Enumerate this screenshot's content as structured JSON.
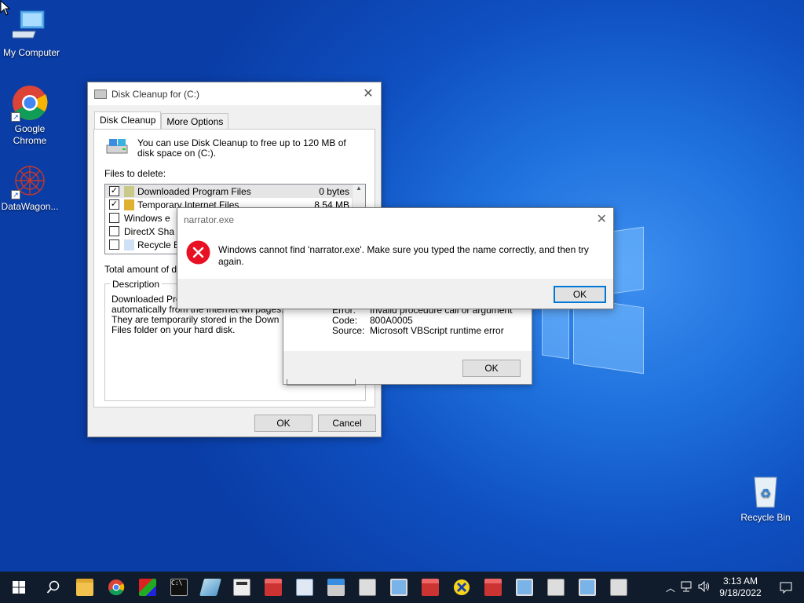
{
  "desktop": {
    "icons": [
      {
        "label": "My Computer"
      },
      {
        "label": "Google Chrome"
      },
      {
        "label": "DataWagon..."
      },
      {
        "label": "Recycle Bin"
      }
    ]
  },
  "disk_cleanup": {
    "title": "Disk Cleanup for  (C:)",
    "tabs": [
      "Disk Cleanup",
      "More Options"
    ],
    "intro": "You can use Disk Cleanup to free up to 120 MB of disk space on  (C:).",
    "files_label": "Files to delete:",
    "files": [
      {
        "name": "Downloaded Program Files",
        "size": "0 bytes",
        "checked": true
      },
      {
        "name": "Temporary Internet Files",
        "size": "8.54 MB",
        "checked": true
      },
      {
        "name": "Windows e",
        "size": "",
        "checked": false
      },
      {
        "name": "DirectX Sha",
        "size": "",
        "checked": false
      },
      {
        "name": "Recycle Bin",
        "size": "",
        "checked": false
      }
    ],
    "total_label": "Total amount of disk",
    "description_label": "Description",
    "description_text": "Downloaded Prog downloaded automatically from the Internet wh pages. They are temporarily stored in the Down Files folder on your hard disk.",
    "ok_label": "OK",
    "cancel_label": "Cancel"
  },
  "vbs_error": {
    "error_label": "Error:",
    "error_value": "Invalid procedure call or argument",
    "code_label": "Code:",
    "code_value": "800A0005",
    "source_label": "Source:",
    "source_value": "Microsoft VBScript runtime error",
    "ok_label": "OK"
  },
  "narrator_dialog": {
    "title": "narrator.exe",
    "message": "Windows cannot find 'narrator.exe'. Make sure you typed the name correctly, and then try again.",
    "ok_label": "OK"
  },
  "taskbar": {
    "time": "3:13 AM",
    "date": "9/18/2022"
  },
  "colors": {
    "accent": "#0078d7",
    "error_red": "#e81123",
    "taskbar": "#101c2c"
  }
}
